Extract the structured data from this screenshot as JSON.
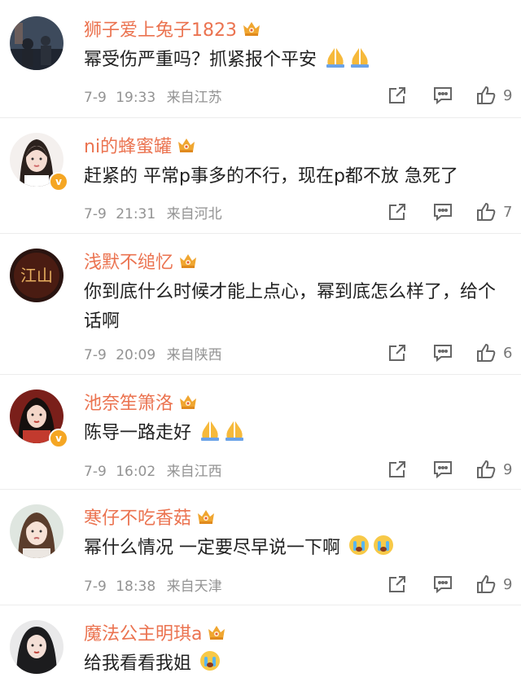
{
  "colors": {
    "username": "#eb7350",
    "meta": "#939393",
    "badge": "#f5a623"
  },
  "comments": [
    {
      "username": "狮子爱上兔子1823",
      "verified": false,
      "avatar": "avatar-dark-scene",
      "text": "幂受伤严重吗？抓紧报个平安",
      "emojis": [
        "pray-emoji",
        "pray-emoji"
      ],
      "date": "7-9",
      "time": "19:33",
      "location": "来自江苏",
      "likes": "9"
    },
    {
      "username": "ni的蜂蜜罐",
      "verified": true,
      "avatar": "avatar-girl-white",
      "text": "赶紧的 平常p事多的不行，现在p都不放 急死了",
      "emojis": [],
      "date": "7-9",
      "time": "21:31",
      "location": "来自河北",
      "likes": "7"
    },
    {
      "username": "浅默不缒忆",
      "verified": false,
      "avatar": "avatar-calligraphy",
      "avatar_text": "江山",
      "text": "你到底什么时候才能上点心，幂到底怎么样了，给个话啊",
      "emojis": [],
      "date": "7-9",
      "time": "20:09",
      "location": "来自陕西",
      "likes": "6"
    },
    {
      "username": "池奈笙箫洛",
      "verified": true,
      "avatar": "avatar-costume",
      "text": "陈导一路走好",
      "emojis": [
        "pray-emoji",
        "pray-emoji"
      ],
      "date": "7-9",
      "time": "16:02",
      "location": "来自江西",
      "likes": "9"
    },
    {
      "username": "寒仔不吃香菇",
      "verified": false,
      "avatar": "avatar-girl-light",
      "text": "幂什么情况 一定要尽早说一下啊",
      "emojis": [
        "crying-emoji",
        "crying-emoji"
      ],
      "date": "7-9",
      "time": "18:38",
      "location": "来自天津",
      "likes": "9"
    },
    {
      "username": "魔法公主明琪a",
      "verified": false,
      "avatar": "avatar-girl-dark",
      "text": "给我看看我姐",
      "emojis": [
        "crying-emoji"
      ],
      "date": "",
      "time": "",
      "location": "",
      "likes": ""
    }
  ]
}
